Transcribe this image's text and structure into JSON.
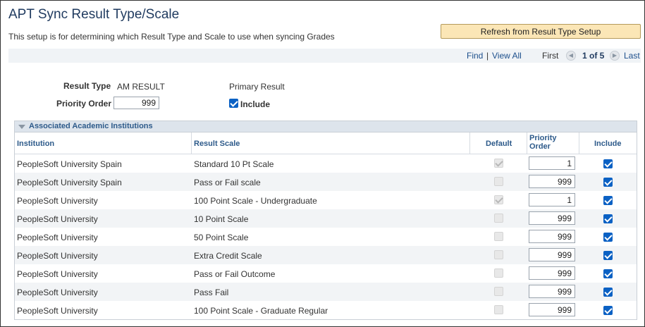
{
  "page": {
    "title": "APT Sync Result Type/Scale",
    "description": "This setup is for determining which Result Type and Scale to use when syncing Grades",
    "refresh_button": "Refresh from Result Type Setup"
  },
  "nav": {
    "find": "Find",
    "separator": "|",
    "view_all": "View All",
    "first": "First",
    "count": "1 of 5",
    "last": "Last"
  },
  "form": {
    "result_type_label": "Result Type",
    "result_type_value": "AM RESULT",
    "primary_result_label": "Primary Result",
    "priority_order_label": "Priority Order",
    "priority_order_value": "999",
    "include_label": "Include",
    "include_checked": true
  },
  "grid": {
    "title": "Associated Academic Institutions",
    "columns": {
      "institution": "Institution",
      "result_scale": "Result Scale",
      "default": "Default",
      "priority_order": "Priority Order",
      "include": "Include"
    },
    "rows": [
      {
        "institution": "PeopleSoft University Spain",
        "scale": "Standard 10 Pt Scale",
        "default": true,
        "priority": "1",
        "include": true
      },
      {
        "institution": "PeopleSoft University Spain",
        "scale": "Pass or Fail scale",
        "default": false,
        "priority": "999",
        "include": true
      },
      {
        "institution": "PeopleSoft University",
        "scale": "100 Point Scale - Undergraduate",
        "default": true,
        "priority": "1",
        "include": true
      },
      {
        "institution": "PeopleSoft University",
        "scale": "10 Point Scale",
        "default": false,
        "priority": "999",
        "include": true
      },
      {
        "institution": "PeopleSoft University",
        "scale": "50 Point Scale",
        "default": false,
        "priority": "999",
        "include": true
      },
      {
        "institution": "PeopleSoft University",
        "scale": "Extra Credit Scale",
        "default": false,
        "priority": "999",
        "include": true
      },
      {
        "institution": "PeopleSoft University",
        "scale": "Pass or Fail Outcome",
        "default": false,
        "priority": "999",
        "include": true
      },
      {
        "institution": "PeopleSoft University",
        "scale": "Pass Fail",
        "default": false,
        "priority": "999",
        "include": true
      },
      {
        "institution": "PeopleSoft University",
        "scale": "100 Point Scale - Graduate Regular",
        "default": false,
        "priority": "999",
        "include": true
      }
    ]
  },
  "colors": {
    "title": "#1f3a5f",
    "link": "#1d4f8c",
    "button_bg": "#fbe6b6",
    "checkbox": "#0b61c4",
    "grid_header": "#dde4ec"
  }
}
